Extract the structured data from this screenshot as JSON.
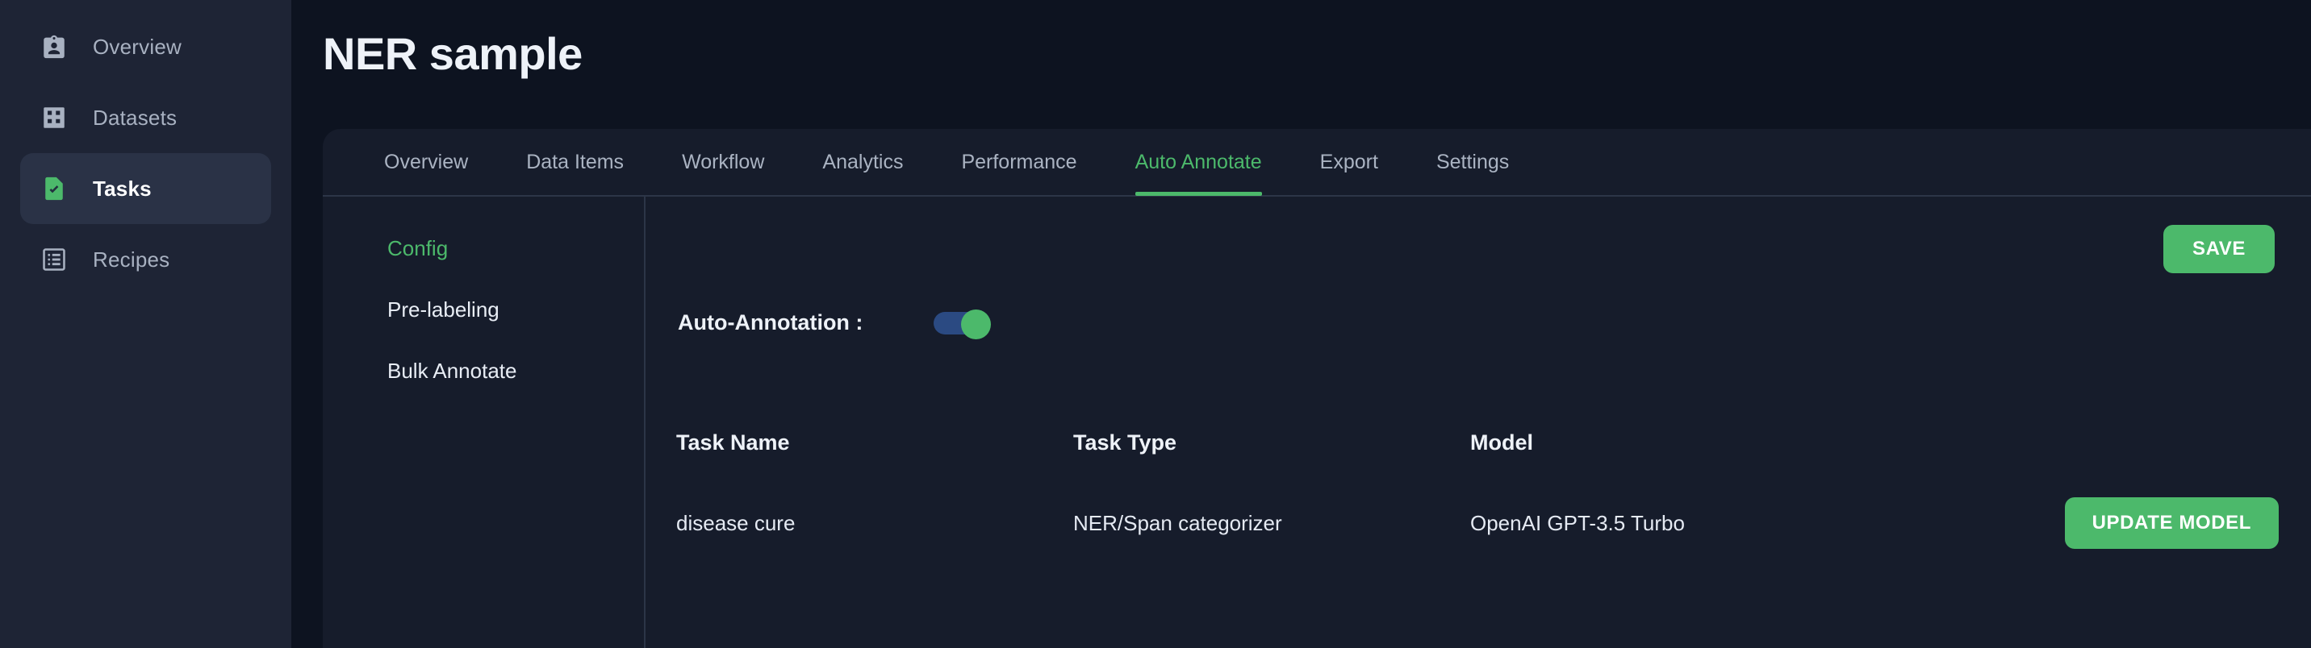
{
  "sidebar": {
    "items": [
      {
        "label": "Overview",
        "icon": "id-badge-icon",
        "active": false
      },
      {
        "label": "Datasets",
        "icon": "grid-icon",
        "active": false
      },
      {
        "label": "Tasks",
        "icon": "task-document-check-icon",
        "active": true
      },
      {
        "label": "Recipes",
        "icon": "list-icon",
        "active": false
      }
    ]
  },
  "header": {
    "title": "NER sample"
  },
  "tabs": [
    {
      "label": "Overview",
      "active": false
    },
    {
      "label": "Data Items",
      "active": false
    },
    {
      "label": "Workflow",
      "active": false
    },
    {
      "label": "Analytics",
      "active": false
    },
    {
      "label": "Performance",
      "active": false
    },
    {
      "label": "Auto Annotate",
      "active": true
    },
    {
      "label": "Export",
      "active": false
    },
    {
      "label": "Settings",
      "active": false
    }
  ],
  "subnav": {
    "items": [
      {
        "label": "Config",
        "active": true
      },
      {
        "label": "Pre-labeling",
        "active": false
      },
      {
        "label": "Bulk Annotate",
        "active": false
      }
    ]
  },
  "config": {
    "save_label": "SAVE",
    "auto_annotation_label": "Auto-Annotation :",
    "auto_annotation_state": "on",
    "table": {
      "headers": [
        "Task Name",
        "Task Type",
        "Model"
      ],
      "rows": [
        {
          "task_name": "disease cure",
          "task_type": "NER/Span categorizer",
          "model": "OpenAI GPT-3.5 Turbo",
          "action_label": "UPDATE MODEL"
        }
      ]
    }
  },
  "colors": {
    "accent_green": "#4cb96b",
    "sidebar_bg": "#1e2435",
    "panel_bg": "#161c2b",
    "page_bg": "#0d1320",
    "toggle_track": "#2b4a82"
  }
}
